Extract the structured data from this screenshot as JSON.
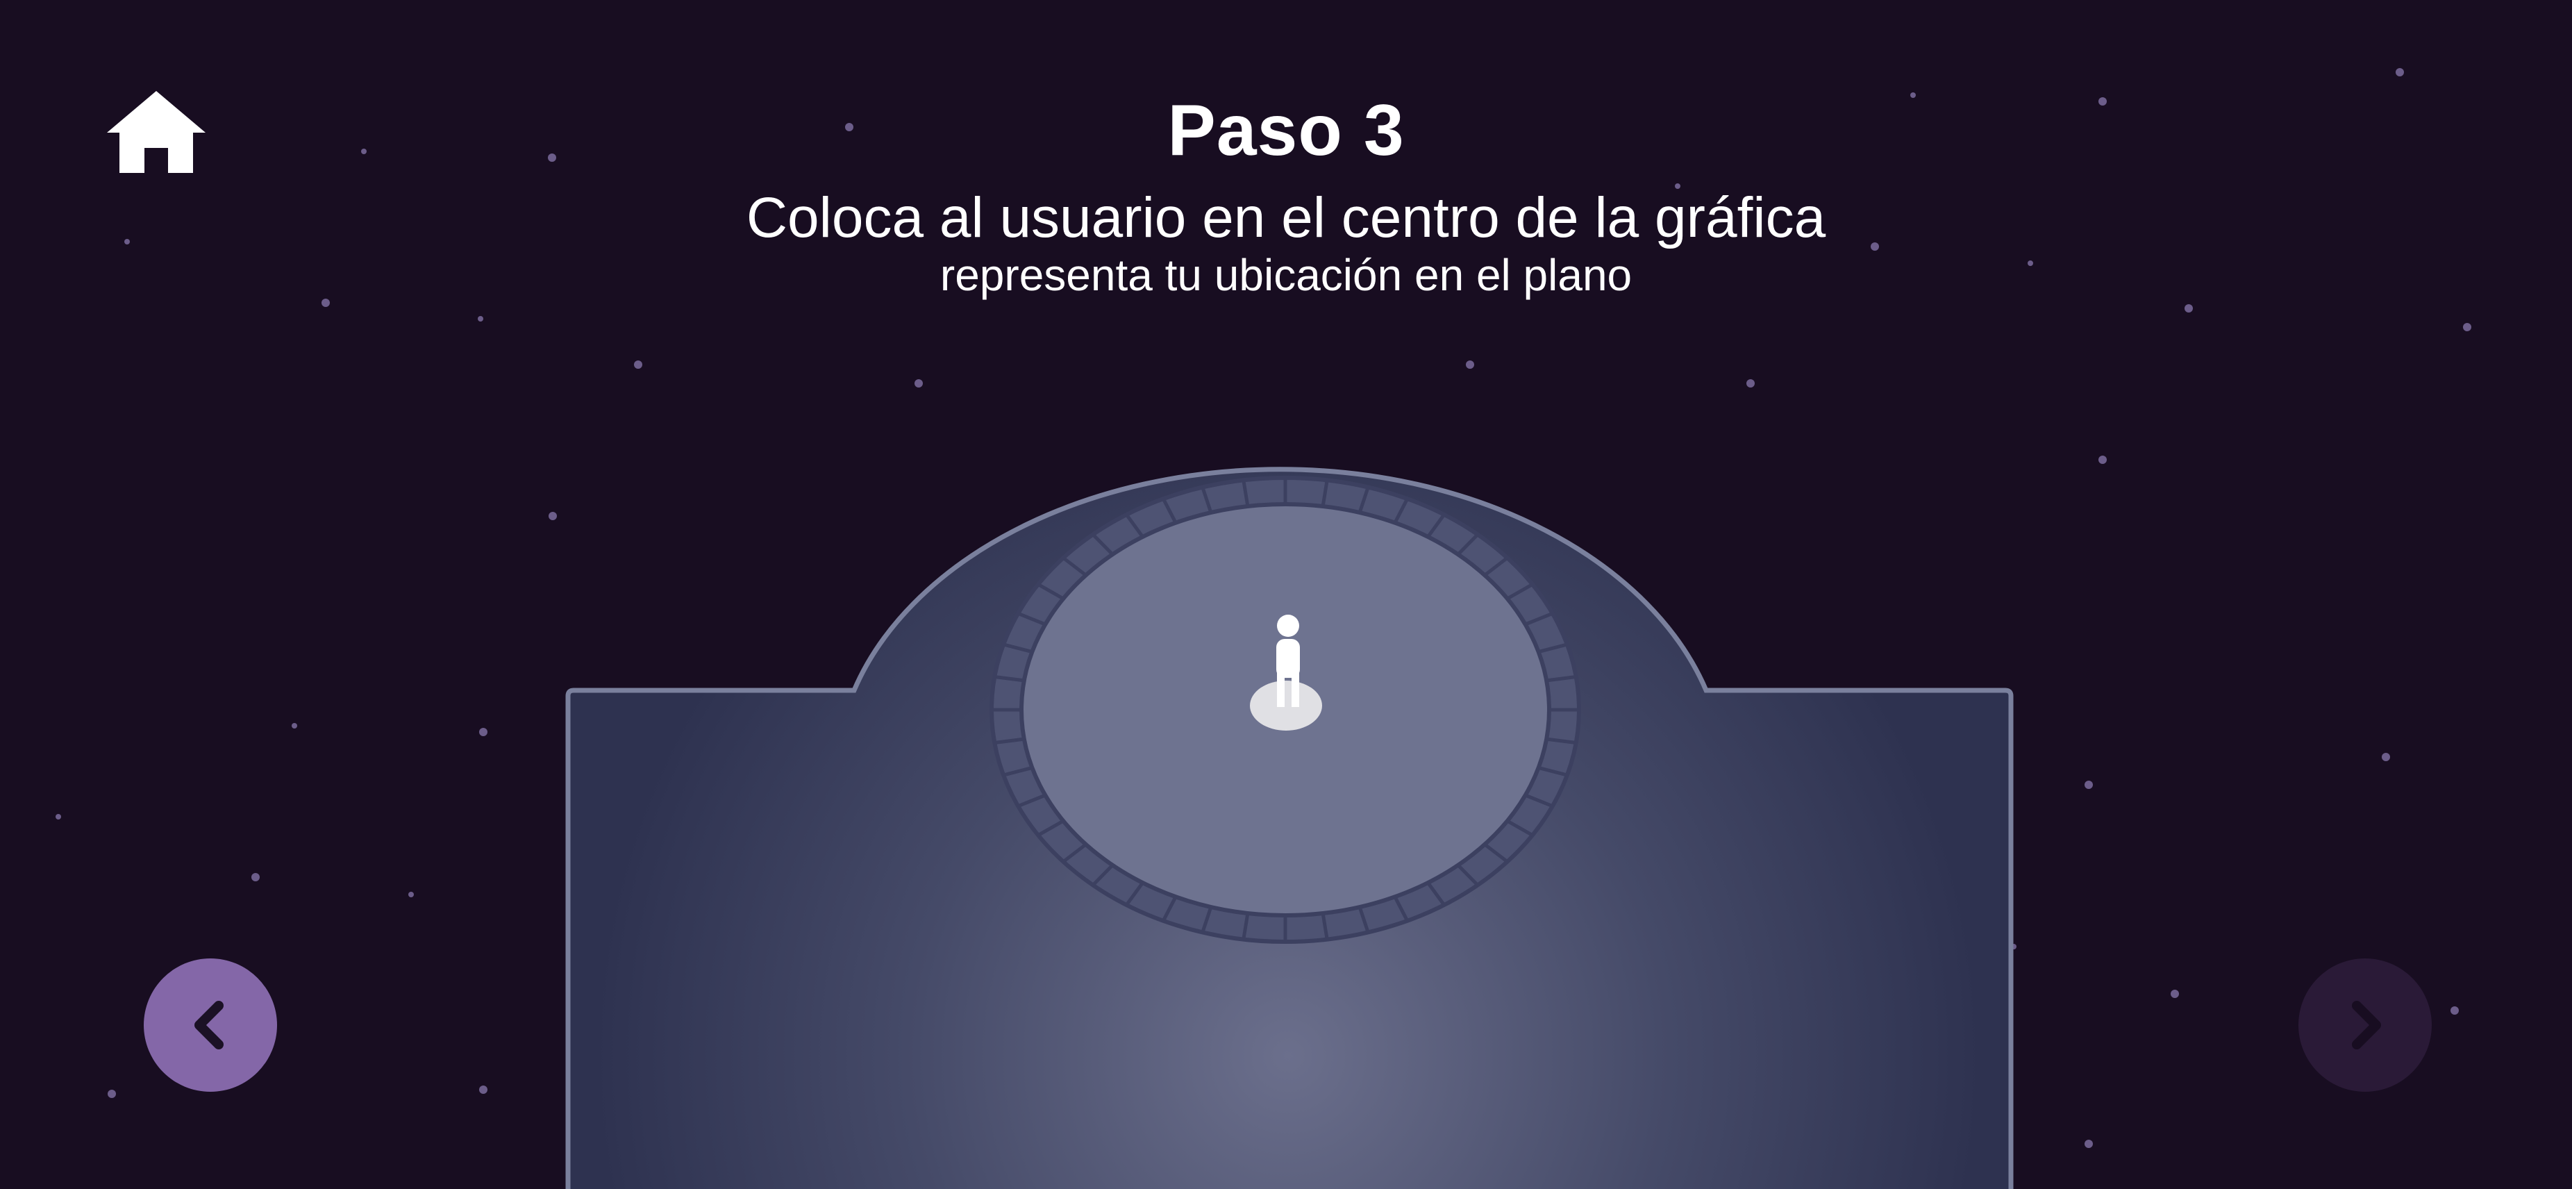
{
  "step": {
    "title": "Paso 3",
    "instruction": "Coloca al usuario en el centro de la gráfica",
    "caption": "representa tu ubicación en el plano"
  },
  "navigation": {
    "home_icon": "home-icon",
    "prev_icon": "chevron-left-icon",
    "next_icon": "chevron-right-icon",
    "prev_enabled": true,
    "next_enabled": false
  },
  "scene": {
    "figure_icon": "user-figure-icon",
    "figure_position": "center"
  },
  "colors": {
    "background": "#180d21",
    "floor": "#2e3250",
    "floor_outline": "#7a809d",
    "inner_circle": "#6e7390",
    "prev_button": "#8467a8",
    "next_button": "#2a1a37",
    "star": "#6c5d8a"
  }
}
